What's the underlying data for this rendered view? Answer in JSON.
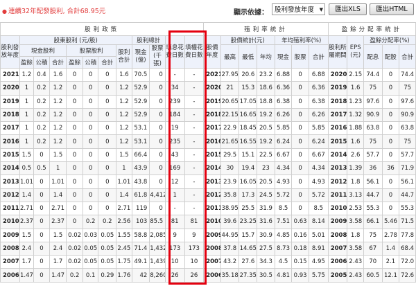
{
  "notice": "連續32年配發股利, 合計68.95元",
  "view_label": "顯示依據：",
  "view_select": "股利發放年度",
  "buttons": {
    "xls": "匯出XLS",
    "html": "匯出HTML"
  },
  "headers": {
    "dividend_policy": "股利政策",
    "dividend_year": "股利發放年度",
    "shareholder_dividend": "股東股利 (元/股)",
    "dividend_total": "股利總計",
    "cash_dividend": "現金股利",
    "stock_dividend": "股票股利",
    "earnings": "盈餘",
    "reserve": "公積",
    "total": "合計",
    "dividend_sum": "股利合計",
    "cash_100m": "現金(億)",
    "stock_1000sh": "股票(千張)",
    "fill_div_days": "填息花費日數",
    "fill_right_days": "填權花費日數",
    "yield_stats": "殖利率統計",
    "stock_year": "股價年度",
    "price_stats": "股價統計(元)",
    "annual_yield": "年均殖利率(%)",
    "high": "最高",
    "low": "最低",
    "avg": "年均",
    "cash": "現金",
    "stock": "股票",
    "payout_stats": "盈餘分配率統計",
    "period": "股利所屬期間",
    "eps": "EPS (元)",
    "payout_rate": "盈餘分配率(%)",
    "pay_earn": "配息",
    "pay_stock": "配股"
  },
  "rows": [
    [
      "2021",
      "1.2",
      "0.4",
      "1.6",
      "0",
      "0",
      "0",
      "1.6",
      "70.5",
      "0",
      "-",
      "-",
      "2021",
      "27.95",
      "20.6",
      "23.2",
      "6.88",
      "0",
      "6.88",
      "2020",
      "2.15",
      "74.4",
      "0",
      "74.4"
    ],
    [
      "2020",
      "1",
      "0.2",
      "1.2",
      "0",
      "0",
      "0",
      "1.2",
      "52.9",
      "0",
      "34",
      "-",
      "2020",
      "21",
      "15.3",
      "18.6",
      "6.36",
      "0",
      "6.36",
      "2019",
      "1.6",
      "75",
      "0",
      "75"
    ],
    [
      "2019",
      "1",
      "0.2",
      "1.2",
      "0",
      "0",
      "0",
      "1.2",
      "52.9",
      "0",
      "239",
      "-",
      "2019",
      "20.65",
      "17.05",
      "18.8",
      "6.38",
      "0",
      "6.38",
      "2018",
      "1.23",
      "97.6",
      "0",
      "97.6"
    ],
    [
      "2018",
      "1",
      "0.2",
      "1.2",
      "0",
      "0",
      "0",
      "1.2",
      "52.9",
      "0",
      "184",
      "-",
      "2018",
      "22.15",
      "16.65",
      "19.2",
      "6.26",
      "0",
      "6.26",
      "2017",
      "1.32",
      "90.9",
      "0",
      "90.9"
    ],
    [
      "2017",
      "1",
      "0.2",
      "1.2",
      "0",
      "0",
      "0",
      "1.2",
      "53.1",
      "0",
      "19",
      "-",
      "2017",
      "22.9",
      "18.45",
      "20.5",
      "5.85",
      "0",
      "5.85",
      "2016",
      "1.88",
      "63.8",
      "0",
      "63.8"
    ],
    [
      "2016",
      "1",
      "0.2",
      "1.2",
      "0",
      "0",
      "0",
      "1.2",
      "53.1",
      "0",
      "235",
      "-",
      "2016",
      "21.65",
      "16.55",
      "19.2",
      "6.24",
      "0",
      "6.24",
      "2015",
      "1.6",
      "75",
      "0",
      "75"
    ],
    [
      "2015",
      "1.5",
      "0",
      "1.5",
      "0",
      "0",
      "0",
      "1.5",
      "66.4",
      "0",
      "43",
      "-",
      "2015",
      "29.5",
      "15.1",
      "22.5",
      "6.67",
      "0",
      "6.67",
      "2014",
      "2.6",
      "57.7",
      "0",
      "57.7"
    ],
    [
      "2014",
      "0.5",
      "0.5",
      "1",
      "0",
      "0",
      "0",
      "1",
      "43.9",
      "0",
      "169",
      "-",
      "2014",
      "30",
      "19.4",
      "23",
      "4.34",
      "0",
      "4.34",
      "2013",
      "1.39",
      "36",
      "36",
      "71.9"
    ],
    [
      "2013",
      "1.01",
      "0",
      "1.01",
      "0",
      "0",
      "0",
      "1.01",
      "43.8",
      "0",
      "12",
      "-",
      "2013",
      "23.9",
      "16.05",
      "20.5",
      "4.93",
      "0",
      "4.93",
      "2012",
      "1.8",
      "56.1",
      "0",
      "56.1"
    ],
    [
      "2012",
      "1.4",
      "0",
      "1.4",
      "0",
      "0",
      "0",
      "1.4",
      "61.8",
      "4,412",
      "1",
      "-",
      "2012",
      "35.8",
      "17.3",
      "24.5",
      "5.72",
      "0",
      "5.72",
      "2011",
      "3.13",
      "44.7",
      "0",
      "44.7"
    ],
    [
      "2011",
      "2.71",
      "0",
      "2.71",
      "0",
      "0",
      "0",
      "2.71",
      "119",
      "0",
      "-",
      "-",
      "2011",
      "38.95",
      "25.5",
      "31.9",
      "8.5",
      "0",
      "8.5",
      "2010",
      "2.53",
      "55.3",
      "0",
      "55.3"
    ],
    [
      "2010",
      "2.37",
      "0",
      "2.37",
      "0",
      "0.2",
      "0.2",
      "2.56",
      "103",
      "85.5",
      "81",
      "81",
      "2010",
      "39.6",
      "23.25",
      "31.6",
      "7.51",
      "0.63",
      "8.14",
      "2009",
      "3.58",
      "66.1",
      "5.46",
      "71.5"
    ],
    [
      "2009",
      "1.5",
      "0",
      "1.5",
      "0.02",
      "0.03",
      "0.05",
      "1.55",
      "58.8",
      "2,085",
      "9",
      "9",
      "2009",
      "44.95",
      "15.7",
      "30.9",
      "4.85",
      "0.16",
      "5.01",
      "2008",
      "1.8",
      "75",
      "2.78",
      "77.8"
    ],
    [
      "2008",
      "2.4",
      "0",
      "2.4",
      "0.02",
      "0.05",
      "0.05",
      "2.45",
      "71.4",
      "1,432",
      "173",
      "173",
      "2008",
      "37.8",
      "14.65",
      "27.5",
      "8.73",
      "0.18",
      "8.91",
      "2007",
      "3.58",
      "67",
      "1.4",
      "68.4"
    ],
    [
      "2007",
      "1.7",
      "0",
      "1.7",
      "0.02",
      "0.05",
      "0.05",
      "1.75",
      "49.1",
      "1,439",
      "10",
      "10",
      "2007",
      "43.2",
      "27.6",
      "34.3",
      "4.5",
      "0.15",
      "4.95",
      "2006",
      "2.43",
      "70",
      "2.1",
      "72.0"
    ],
    [
      "2006",
      "1.47",
      "0",
      "1.47",
      "0.2",
      "0.1",
      "0.29",
      "1.76",
      "42",
      "8,260",
      "26",
      "26",
      "2006",
      "35.18",
      "27.35",
      "30.5",
      "4.81",
      "0.93",
      "5.75",
      "2005",
      "2.43",
      "60.5",
      "12.1",
      "72.6"
    ]
  ]
}
